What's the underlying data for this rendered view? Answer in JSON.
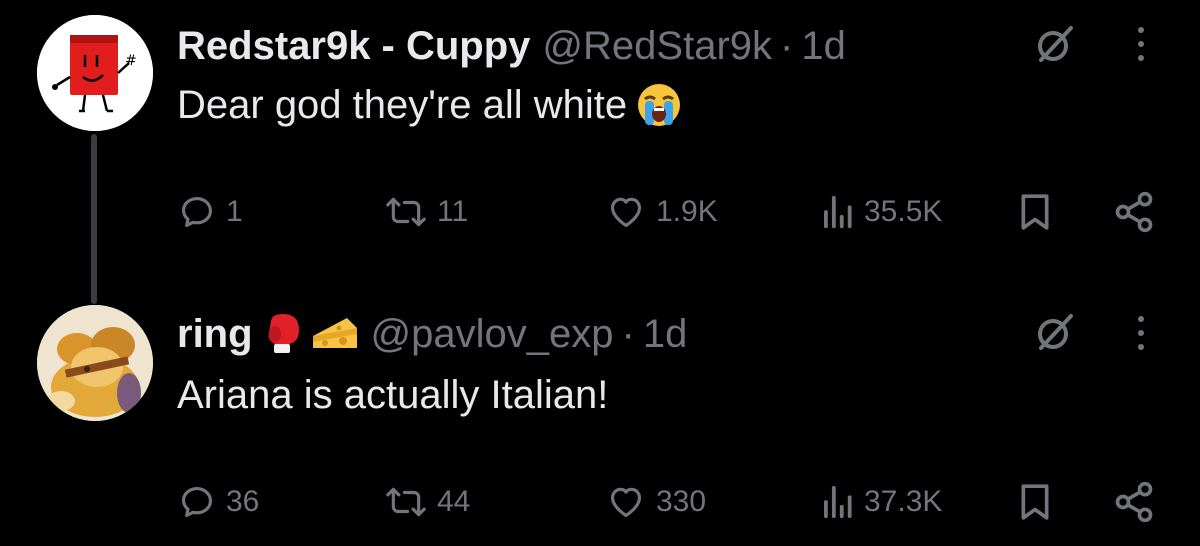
{
  "tweets": [
    {
      "name": "Redstar9k - Cuppy",
      "handle": "@RedStar9k",
      "dot": "·",
      "time": "1d",
      "text": "Dear god they're all white",
      "emoji": "loudly-crying-face",
      "stats": {
        "replies": "1",
        "reposts": "11",
        "likes": "1.9K",
        "views": "35.5K"
      },
      "avatar": "red-cup-character"
    },
    {
      "name": "ring",
      "name_emojis": [
        "boxing-glove",
        "cheese-wedge"
      ],
      "handle": "@pavlov_exp",
      "dot": "·",
      "time": "1d",
      "text": "Ariana is actually Italian!",
      "stats": {
        "replies": "36",
        "reposts": "44",
        "likes": "330",
        "views": "37.3K"
      },
      "avatar": "painted-mouse-character"
    }
  ],
  "colors": {
    "background": "#000000",
    "primary_text": "#e7e9ea",
    "secondary_text": "#71767b",
    "thread_line": "#3a3d40"
  },
  "icons": [
    "reply-icon",
    "repost-icon",
    "like-icon",
    "views-icon",
    "bookmark-icon",
    "share-icon",
    "grok-icon",
    "more-icon"
  ]
}
